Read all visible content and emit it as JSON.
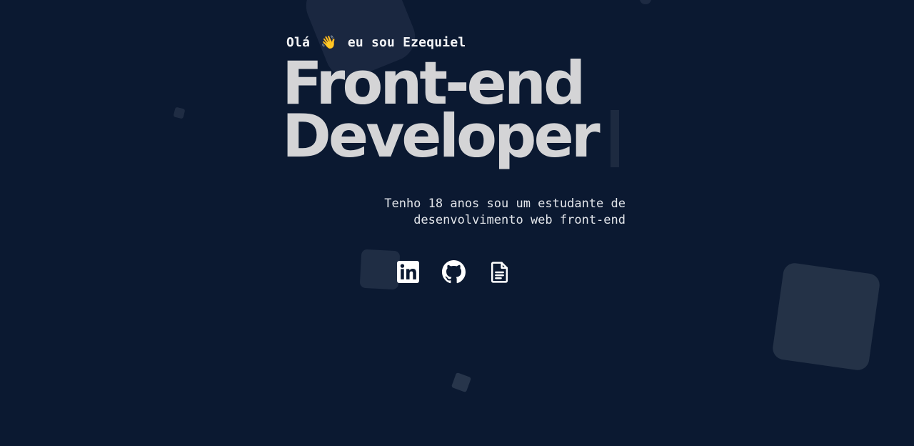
{
  "hero": {
    "greeting_prefix": "Olá",
    "greeting_emoji": "👋",
    "greeting_suffix": "eu sou Ezequiel",
    "headline_line1": "Front-end",
    "headline_line2": "Developer",
    "description": "Tenho 18 anos sou um estudante de desenvolvimento web front-end"
  },
  "socials": [
    {
      "name": "LinkedIn",
      "icon": "linkedin-icon"
    },
    {
      "name": "GitHub",
      "icon": "github-icon"
    },
    {
      "name": "Currículo",
      "icon": "document-icon"
    }
  ],
  "colors": {
    "background": "#0b1931",
    "headline": "#d4d4d6",
    "text": "#e2e5ea",
    "shape": "#1f2d44"
  }
}
